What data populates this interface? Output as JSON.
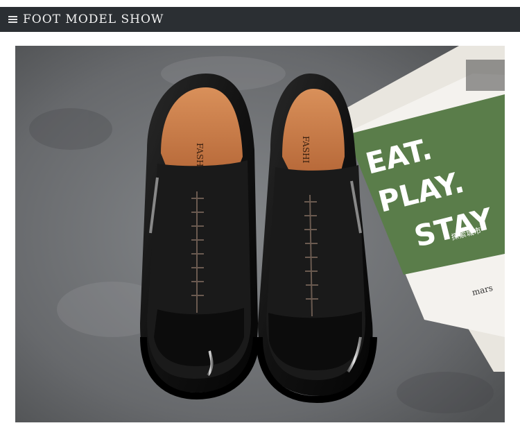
{
  "header": {
    "title": "FOOT MODEL SHOW",
    "menu_icon": "menu-icon"
  },
  "photo": {
    "subject": "black-leather-slip-on-shoes",
    "insole_text": "FASHI",
    "magazine": {
      "headline_lines": [
        "EAT.",
        "PLAY.",
        "STAY"
      ],
      "subtitle": "探索城市",
      "footer": "mars"
    }
  },
  "colors": {
    "header_bg": "#2b2f33",
    "magazine_green": "#5a7d4a"
  }
}
